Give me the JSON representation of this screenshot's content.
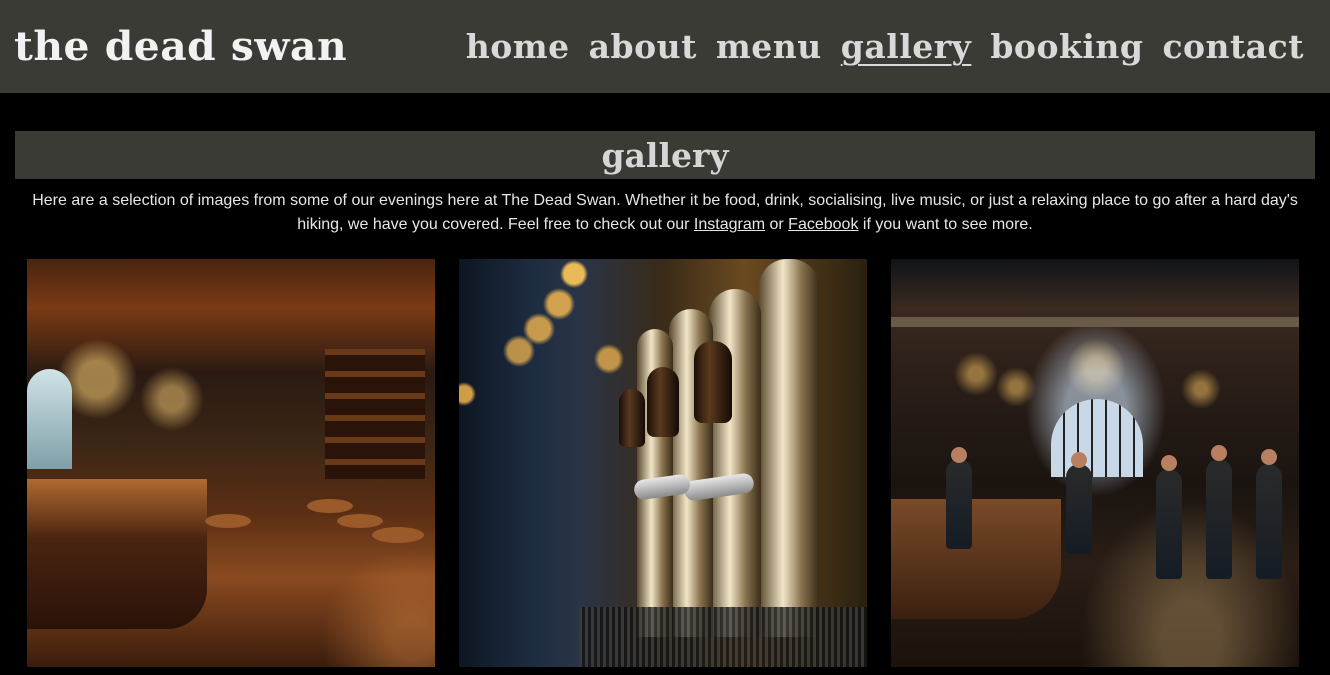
{
  "brand": {
    "name": "the dead swan"
  },
  "nav": {
    "items": [
      {
        "label": "home"
      },
      {
        "label": "about"
      },
      {
        "label": "menu"
      },
      {
        "label": "gallery",
        "active": true
      },
      {
        "label": "booking"
      },
      {
        "label": "contact"
      }
    ]
  },
  "page": {
    "title": "gallery",
    "intro_before": "Here are a selection of images from some of our evenings here at The Dead Swan. Whether it be food, drink, socialising, live music, or just a relaxing place to go after a hard day's hiking, we have you covered. Feel free to check out our ",
    "instagram_link": "Instagram",
    "intro_or": " or ",
    "facebook_link": "Facebook",
    "intro_after": " if you want to see more."
  },
  "colors": {
    "header_bg": "#3a3b35",
    "page_bg": "#000000",
    "text": "#e6e6e6"
  }
}
